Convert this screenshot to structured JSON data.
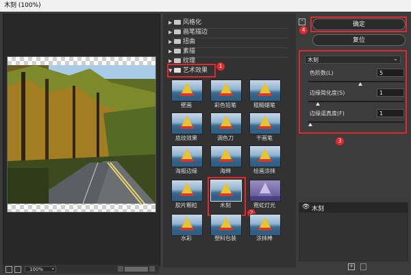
{
  "window": {
    "title": "木刻 (100%)"
  },
  "preview": {
    "zoom": "100%"
  },
  "categories": [
    {
      "label": "风格化",
      "expanded": false
    },
    {
      "label": "画笔描边",
      "expanded": false
    },
    {
      "label": "扭曲",
      "expanded": false
    },
    {
      "label": "素描",
      "expanded": false
    },
    {
      "label": "纹理",
      "expanded": false
    },
    {
      "label": "艺术效果",
      "expanded": true
    }
  ],
  "filters": [
    {
      "label": "壁画"
    },
    {
      "label": "彩色铅笔"
    },
    {
      "label": "粗糙蜡笔"
    },
    {
      "label": "底纹效果"
    },
    {
      "label": "调色刀"
    },
    {
      "label": "干画笔"
    },
    {
      "label": "海报边缘"
    },
    {
      "label": "海绵"
    },
    {
      "label": "绘画涂抹"
    },
    {
      "label": "胶片颗粒"
    },
    {
      "label": "木刻"
    },
    {
      "label": "霓虹灯光"
    },
    {
      "label": "水彩"
    },
    {
      "label": "塑料包装"
    },
    {
      "label": "涂抹棒"
    }
  ],
  "buttons": {
    "ok": "确定",
    "reset": "复位"
  },
  "effect": {
    "selected": "木刻"
  },
  "params": [
    {
      "label": "色阶数(L)",
      "value": "5",
      "level": 0.54
    },
    {
      "label": "边缘简化度(S)",
      "value": "1",
      "level": 0.1
    },
    {
      "label": "边缘逼真度(F)",
      "value": "1",
      "level": 0.02
    }
  ],
  "layers": [
    {
      "name": "木刻"
    }
  ],
  "annotations": {
    "b1": "1",
    "b2": "2",
    "b3": "3",
    "b4": "4"
  },
  "colors": {
    "highlight": "#e0282e",
    "panel": "#323232",
    "background": "#3c3c3c"
  }
}
